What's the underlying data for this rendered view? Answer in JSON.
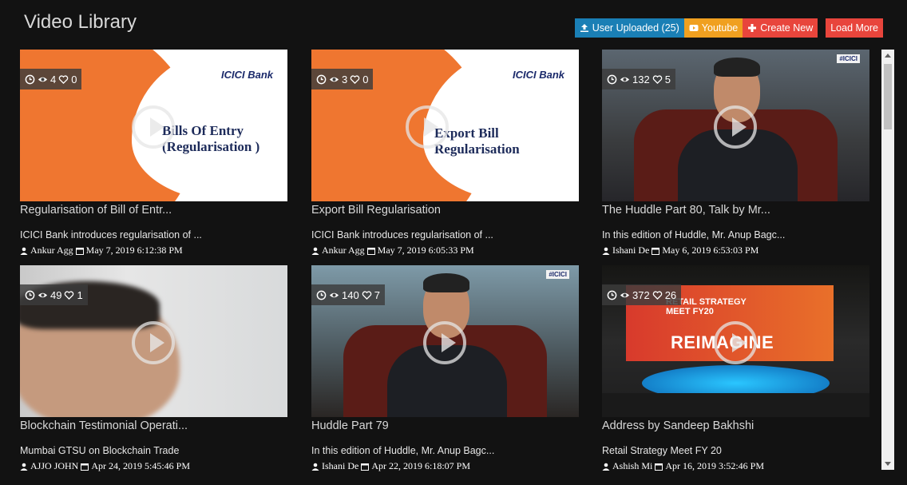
{
  "header": {
    "title": "Video Library",
    "buttons": {
      "user_uploaded": "User Uploaded (25)",
      "youtube": "Youtube",
      "create_new": "Create New",
      "load_more": "Load More"
    }
  },
  "videos": [
    {
      "views": "4",
      "likes": "0",
      "title": "Regularisation of Bill of Entr...",
      "description": "ICICI Bank introduces regularisation of ...",
      "author": "Ankur Agg",
      "date": "May 7, 2019 6:12:38 PM",
      "thumb_logo": "ICICI Bank",
      "thumb_text_1": "Bills Of Entry",
      "thumb_text_2": "(Regularisation )"
    },
    {
      "views": "3",
      "likes": "0",
      "title": "Export Bill Regularisation",
      "description": "ICICI Bank introduces regularisation of ...",
      "author": "Ankur Agg",
      "date": "May 7, 2019 6:05:33 PM",
      "thumb_logo": "ICICI Bank",
      "thumb_text_1": "Export Bill",
      "thumb_text_2": "Regularisation"
    },
    {
      "views": "132",
      "likes": "5",
      "title": "The Huddle Part 80, Talk by Mr...",
      "description": "In this edition of Huddle, Mr. Anup Bagc...",
      "author": "Ishani De",
      "date": "May 6, 2019 6:53:03 PM",
      "thumb_logo": "#ICICI"
    },
    {
      "views": "49",
      "likes": "1",
      "title": "Blockchain Testimonial Operati...",
      "description": "Mumbai GTSU on Blockchain Trade",
      "author": "AJJO JOHN",
      "date": "Apr 24, 2019 5:45:46 PM"
    },
    {
      "views": "140",
      "likes": "7",
      "title": "Huddle Part 79",
      "description": "In this edition of Huddle, Mr. Anup Bagc...",
      "author": "Ishani De",
      "date": "Apr 22, 2019 6:18:07 PM",
      "thumb_logo": "#ICICI"
    },
    {
      "views": "372",
      "likes": "26",
      "title": "Address by Sandeep Bakhshi",
      "description": "Retail Strategy Meet FY 20",
      "author": "Ashish Mi",
      "date": "Apr 16, 2019 3:52:46 PM",
      "thumb_text_1": "RETAIL STRATEGY",
      "thumb_text_2": "MEET FY20",
      "thumb_text_3": "REIMAGINE"
    }
  ],
  "colors": {
    "background": "#121212",
    "user_uploaded_btn": "#1a7fb5",
    "youtube_btn": "#f0a020",
    "create_btn": "#e8453c",
    "load_more_btn": "#e8453c"
  }
}
